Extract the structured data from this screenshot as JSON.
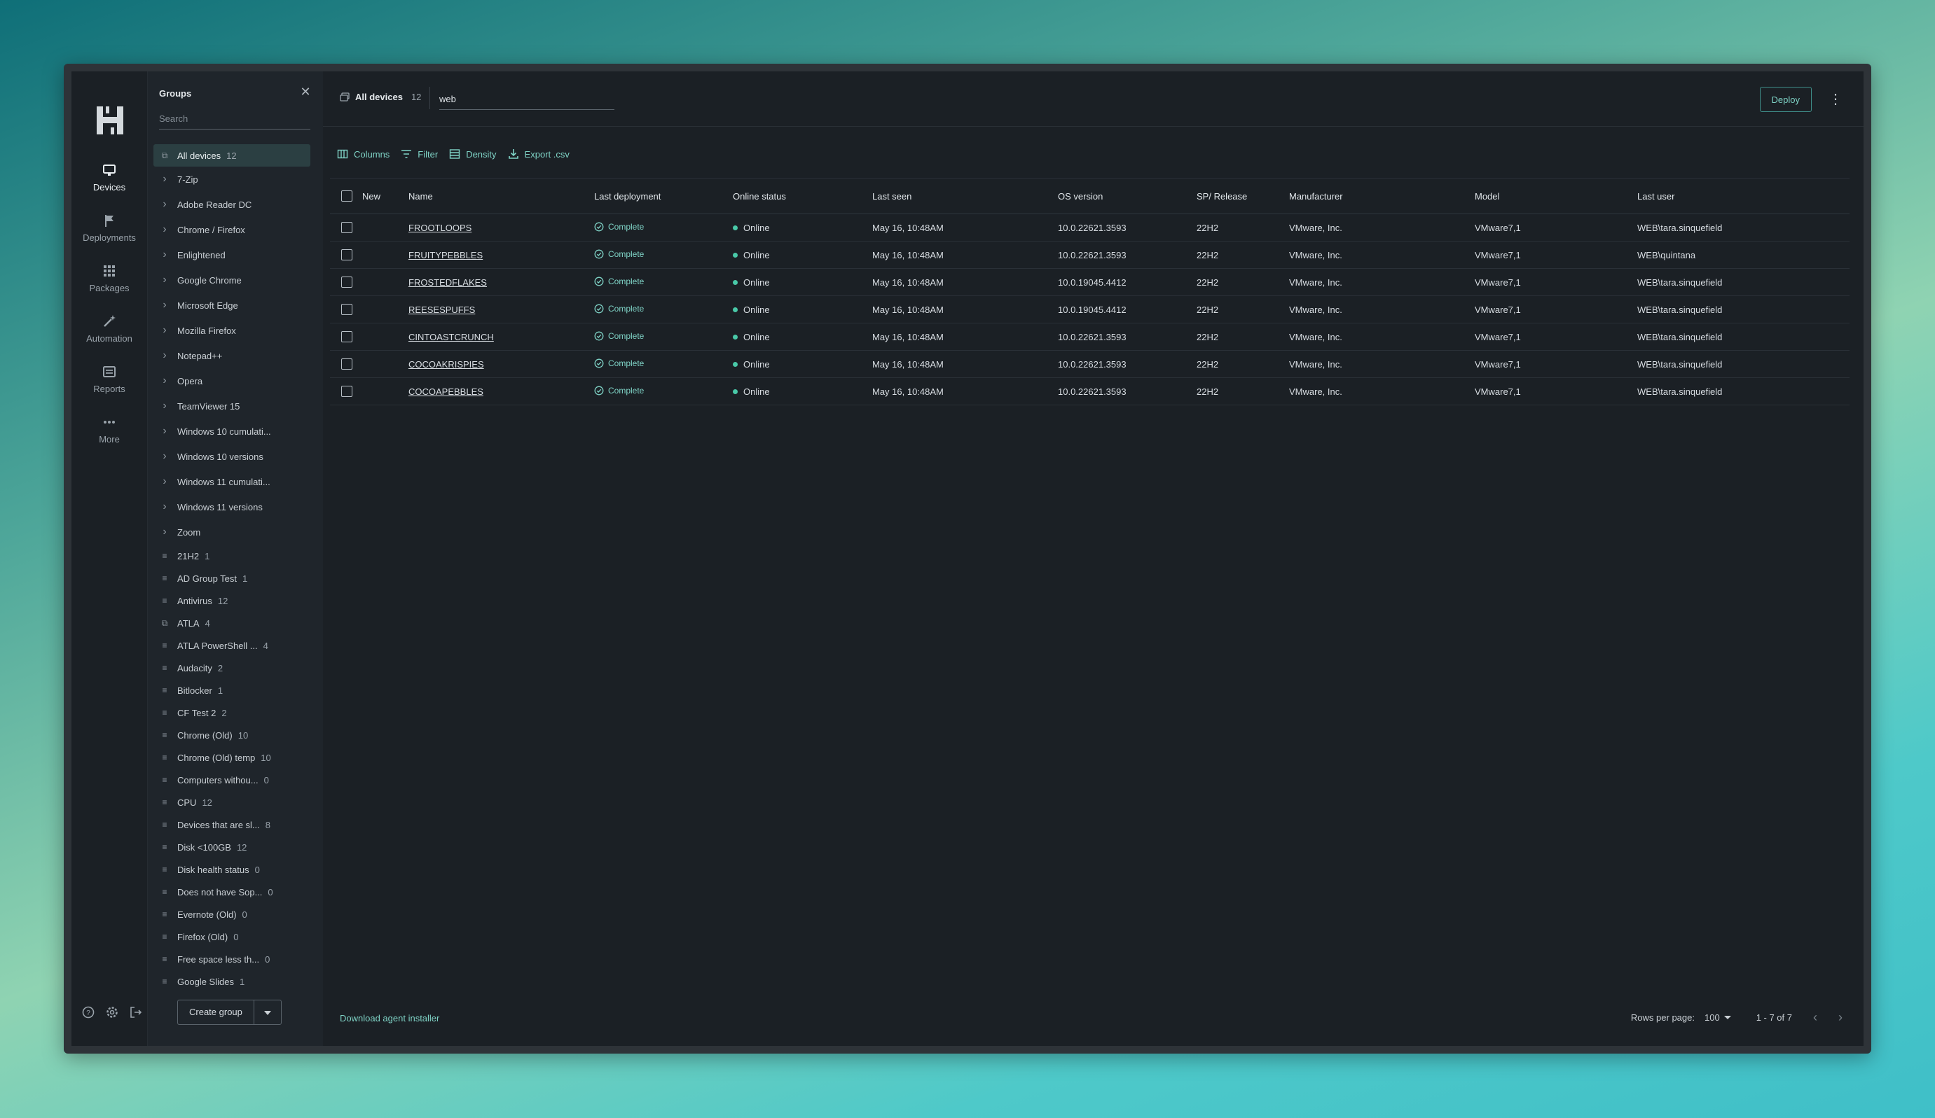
{
  "rail": {
    "items": [
      {
        "label": "Devices",
        "icon": "monitor-icon"
      },
      {
        "label": "Deployments",
        "icon": "flag-icon"
      },
      {
        "label": "Packages",
        "icon": "grid-icon"
      },
      {
        "label": "Automation",
        "icon": "wand-icon"
      },
      {
        "label": "Reports",
        "icon": "report-icon"
      },
      {
        "label": "More",
        "icon": "more-icon"
      }
    ]
  },
  "groups": {
    "title": "Groups",
    "search_placeholder": "Search",
    "create_label": "Create group",
    "items": [
      {
        "label": "All devices",
        "count": "12",
        "type": "device"
      },
      {
        "label": "7-Zip",
        "count": "",
        "type": "folder"
      },
      {
        "label": "Adobe Reader DC",
        "count": "",
        "type": "folder"
      },
      {
        "label": "Chrome / Firefox",
        "count": "",
        "type": "folder"
      },
      {
        "label": "Enlightened",
        "count": "",
        "type": "folder"
      },
      {
        "label": "Google Chrome",
        "count": "",
        "type": "folder"
      },
      {
        "label": "Microsoft Edge",
        "count": "",
        "type": "folder"
      },
      {
        "label": "Mozilla Firefox",
        "count": "",
        "type": "folder"
      },
      {
        "label": "Notepad++",
        "count": "",
        "type": "folder"
      },
      {
        "label": "Opera",
        "count": "",
        "type": "folder"
      },
      {
        "label": "TeamViewer 15",
        "count": "",
        "type": "folder"
      },
      {
        "label": "Windows 10 cumulati...",
        "count": "",
        "type": "folder"
      },
      {
        "label": "Windows 10 versions",
        "count": "",
        "type": "folder"
      },
      {
        "label": "Windows 11 cumulati...",
        "count": "",
        "type": "folder"
      },
      {
        "label": "Windows 11 versions",
        "count": "",
        "type": "folder"
      },
      {
        "label": "Zoom",
        "count": "",
        "type": "folder"
      },
      {
        "label": "21H2",
        "count": "1",
        "type": "filter"
      },
      {
        "label": "AD Group Test",
        "count": "1",
        "type": "filter"
      },
      {
        "label": "Antivirus",
        "count": "12",
        "type": "filter"
      },
      {
        "label": "ATLA",
        "count": "4",
        "type": "device"
      },
      {
        "label": "ATLA PowerShell ...",
        "count": "4",
        "type": "filter"
      },
      {
        "label": "Audacity",
        "count": "2",
        "type": "filter"
      },
      {
        "label": "Bitlocker",
        "count": "1",
        "type": "filter"
      },
      {
        "label": "CF Test 2",
        "count": "2",
        "type": "filter"
      },
      {
        "label": "Chrome (Old)",
        "count": "10",
        "type": "filter"
      },
      {
        "label": "Chrome (Old) temp",
        "count": "10",
        "type": "filter"
      },
      {
        "label": "Computers withou...",
        "count": "0",
        "type": "filter"
      },
      {
        "label": "CPU",
        "count": "12",
        "type": "filter"
      },
      {
        "label": "Devices that are sl...",
        "count": "8",
        "type": "filter"
      },
      {
        "label": "Disk <100GB",
        "count": "12",
        "type": "filter"
      },
      {
        "label": "Disk health status",
        "count": "0",
        "type": "filter"
      },
      {
        "label": "Does not have Sop...",
        "count": "0",
        "type": "filter"
      },
      {
        "label": "Evernote (Old)",
        "count": "0",
        "type": "filter"
      },
      {
        "label": "Firefox (Old)",
        "count": "0",
        "type": "filter"
      },
      {
        "label": "Free space less th...",
        "count": "0",
        "type": "filter"
      },
      {
        "label": "Google Slides",
        "count": "1",
        "type": "filter"
      }
    ]
  },
  "topbar": {
    "all_devices_label": "All devices",
    "all_devices_count": "12",
    "search_value": "web",
    "deploy_label": "Deploy"
  },
  "toolbar": {
    "columns_label": "Columns",
    "filter_label": "Filter",
    "density_label": "Density",
    "export_label": "Export .csv"
  },
  "table": {
    "headers": [
      "New",
      "Name",
      "Last deployment",
      "Online status",
      "Last seen",
      "OS version",
      "SP/ Release",
      "Manufacturer",
      "Model",
      "Last user"
    ],
    "rows": [
      {
        "name": "FROOTLOOPS",
        "deployment": "Complete",
        "status": "Online",
        "last_seen": "May 16, 10:48AM",
        "os": "10.0.22621.3593",
        "sp": "22H2",
        "manufacturer": "VMware, Inc.",
        "model": "VMware7,1",
        "user": "WEB\\tara.sinquefield"
      },
      {
        "name": "FRUITYPEBBLES",
        "deployment": "Complete",
        "status": "Online",
        "last_seen": "May 16, 10:48AM",
        "os": "10.0.22621.3593",
        "sp": "22H2",
        "manufacturer": "VMware, Inc.",
        "model": "VMware7,1",
        "user": "WEB\\quintana"
      },
      {
        "name": "FROSTEDFLAKES",
        "deployment": "Complete",
        "status": "Online",
        "last_seen": "May 16, 10:48AM",
        "os": "10.0.19045.4412",
        "sp": "22H2",
        "manufacturer": "VMware, Inc.",
        "model": "VMware7,1",
        "user": "WEB\\tara.sinquefield"
      },
      {
        "name": "REESESPUFFS",
        "deployment": "Complete",
        "status": "Online",
        "last_seen": "May 16, 10:48AM",
        "os": "10.0.19045.4412",
        "sp": "22H2",
        "manufacturer": "VMware, Inc.",
        "model": "VMware7,1",
        "user": "WEB\\tara.sinquefield"
      },
      {
        "name": "CINTOASTCRUNCH",
        "deployment": "Complete",
        "status": "Online",
        "last_seen": "May 16, 10:48AM",
        "os": "10.0.22621.3593",
        "sp": "22H2",
        "manufacturer": "VMware, Inc.",
        "model": "VMware7,1",
        "user": "WEB\\tara.sinquefield"
      },
      {
        "name": "COCOAKRISPIES",
        "deployment": "Complete",
        "status": "Online",
        "last_seen": "May 16, 10:48AM",
        "os": "10.0.22621.3593",
        "sp": "22H2",
        "manufacturer": "VMware, Inc.",
        "model": "VMware7,1",
        "user": "WEB\\tara.sinquefield"
      },
      {
        "name": "COCOAPEBBLES",
        "deployment": "Complete",
        "status": "Online",
        "last_seen": "May 16, 10:48AM",
        "os": "10.0.22621.3593",
        "sp": "22H2",
        "manufacturer": "VMware, Inc.",
        "model": "VMware7,1",
        "user": "WEB\\tara.sinquefield"
      }
    ]
  },
  "footer": {
    "download_label": "Download agent installer",
    "rows_per_page_label": "Rows per page:",
    "rows_per_page_value": "100",
    "range": "1 - 7 of 7"
  },
  "colors": {
    "accent": "#7fd3c6",
    "online": "#49c9a8",
    "background": "#1b2025"
  }
}
